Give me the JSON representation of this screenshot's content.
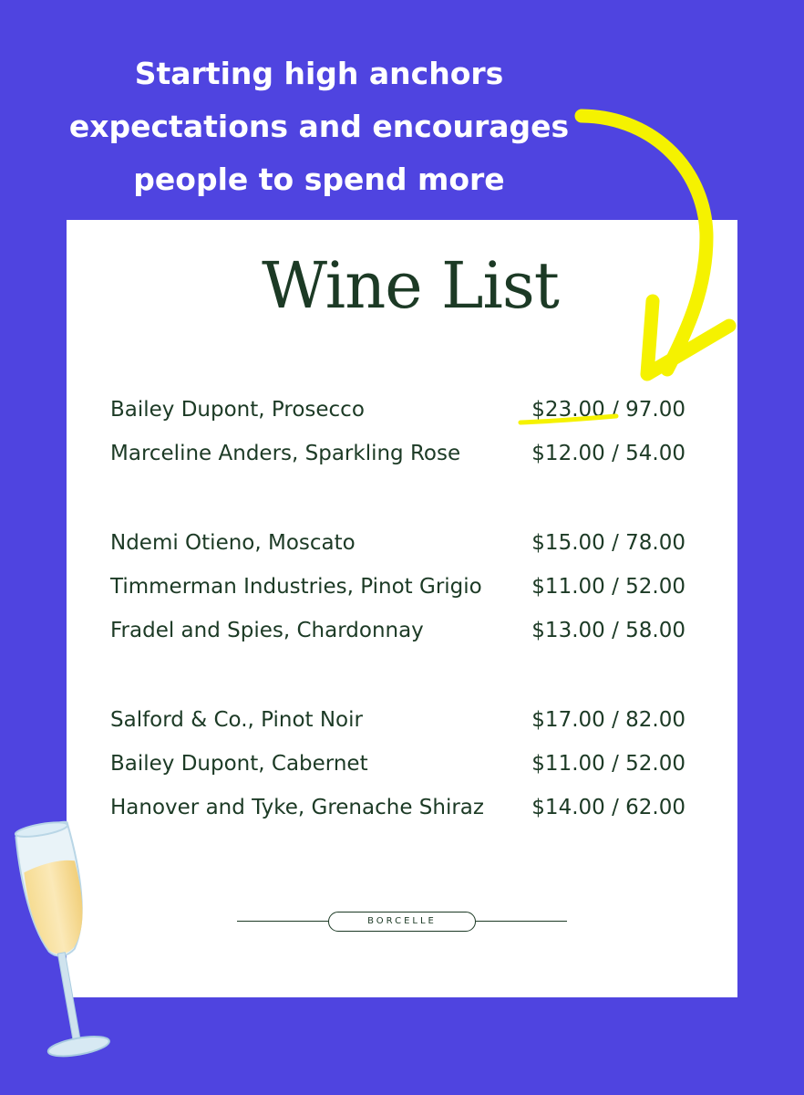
{
  "headline": {
    "line1": "Starting high anchors",
    "line2": "expectations and encourages",
    "line3": "people to spend more"
  },
  "menu": {
    "title": "Wine List",
    "groups": [
      [
        {
          "name": "Bailey Dupont, Prosecco",
          "price": "$23.00 / 97.00"
        },
        {
          "name": "Marceline Anders, Sparkling Rose",
          "price": "$12.00 / 54.00"
        }
      ],
      [
        {
          "name": "Ndemi Otieno, Moscato",
          "price": "$15.00 / 78.00"
        },
        {
          "name": "Timmerman Industries, Pinot Grigio",
          "price": "$11.00 / 52.00"
        },
        {
          "name": "Fradel and Spies, Chardonnay",
          "price": "$13.00 / 58.00"
        }
      ],
      [
        {
          "name": "Salford & Co., Pinot Noir",
          "price": "$17.00 / 82.00"
        },
        {
          "name": "Bailey Dupont, Cabernet",
          "price": "$11.00 / 52.00"
        },
        {
          "name": "Hanover and Tyke, Grenache Shiraz",
          "price": "$14.00 / 62.00"
        }
      ]
    ],
    "brand": "BORCELLE"
  },
  "colors": {
    "background": "#4f44e0",
    "card": "#ffffff",
    "text": "#1c3a25",
    "highlight": "#f5f200"
  },
  "icons": {
    "arrow": "curved-arrow-icon",
    "glass": "champagne-glass-icon"
  }
}
